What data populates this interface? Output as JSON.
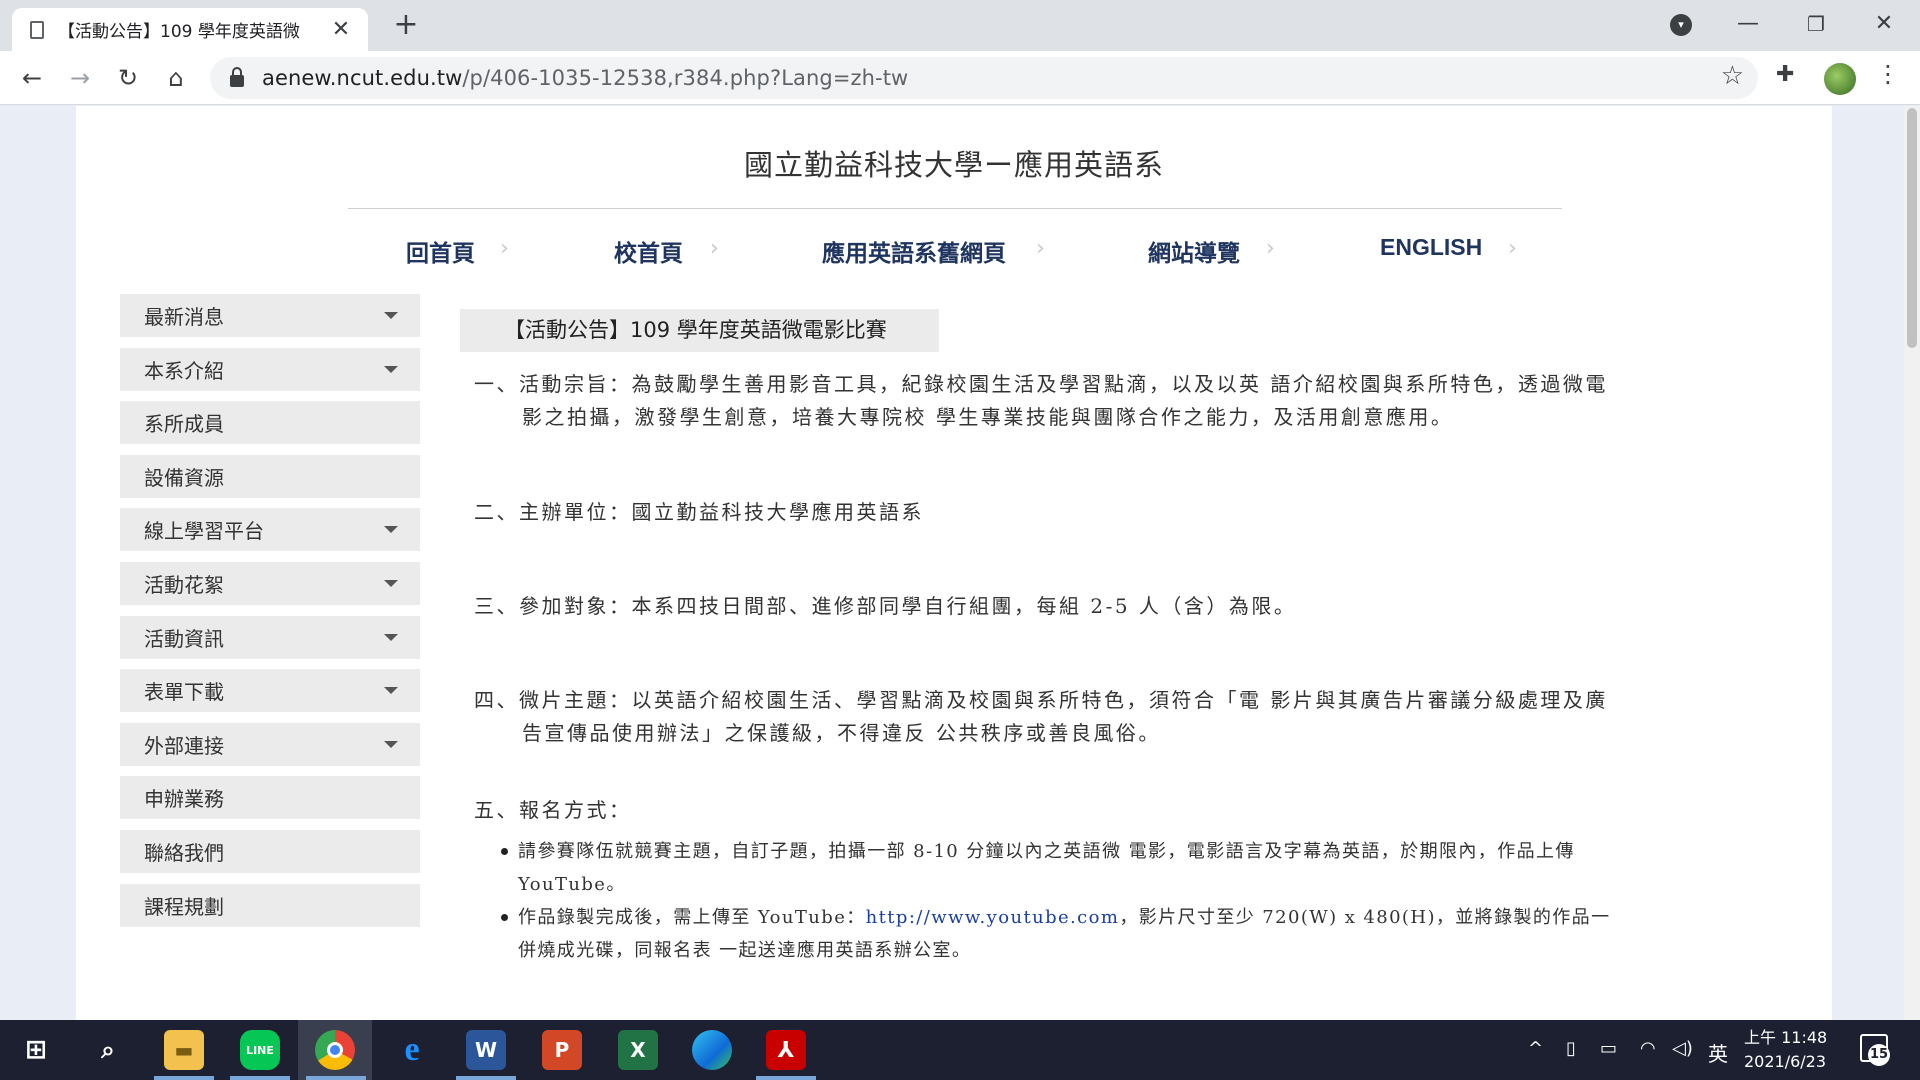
{
  "browser": {
    "tab_title": "【活動公告】109 學年度英語微",
    "url_host": "aenew.ncut.edu.tw",
    "url_path": "/p/406-1035-12538,r384.php?Lang=zh-tw"
  },
  "site": {
    "title": "國立勤益科技大學ー應用英語系",
    "nav": [
      "回首頁",
      "校首頁",
      "應用英語系舊網頁",
      "網站導覽",
      "ENGLISH"
    ]
  },
  "sidebar": {
    "items": [
      {
        "label": "最新消息",
        "has_submenu": true
      },
      {
        "label": "本系介紹",
        "has_submenu": true
      },
      {
        "label": "系所成員",
        "has_submenu": false
      },
      {
        "label": "設備資源",
        "has_submenu": false
      },
      {
        "label": "線上學習平台",
        "has_submenu": true
      },
      {
        "label": "活動花絮",
        "has_submenu": true
      },
      {
        "label": "活動資訊",
        "has_submenu": true
      },
      {
        "label": "表單下載",
        "has_submenu": true
      },
      {
        "label": "外部連接",
        "has_submenu": true
      },
      {
        "label": "申辦業務",
        "has_submenu": false
      },
      {
        "label": "聯絡我們",
        "has_submenu": false
      },
      {
        "label": "課程規劃",
        "has_submenu": false
      }
    ]
  },
  "post": {
    "title": "【活動公告】109 學年度英語微電影比賽",
    "sections": [
      "一、活動宗旨：為鼓勵學生善用影音工具，紀錄校園生活及學習點滴，以及以英 語介紹校園與系所特色，透過微電影之拍攝，激發學生創意，培養大專院校 學生專業技能與團隊合作之能力，及活用創意應用。",
      "二、主辦單位：國立勤益科技大學應用英語系",
      "三、參加對象：本系四技日間部、進修部同學自行組團，每組 2-5 人（含）為限。",
      "四、微片主題：以英語介紹校園生活、學習點滴及校園與系所特色，須符合「電 影片與其廣告片審議分級處理及廣告宣傳品使用辦法」之保護級，不得違反 公共秩序或善良風俗。",
      "五、報名方式："
    ],
    "bullet1": "請參賽隊伍就競賽主題，自訂子題，拍攝一部 8-10 分鐘以內之英語微 電影，電影語言及字幕為英語，於期限內，作品上傳 YouTube。",
    "bullet2_pre": "作品錄製完成後，需上傳至 YouTube：",
    "bullet2_link": "http://www.youtube.com",
    "bullet2_post": "，影片尺寸至少 720(W) x 480(H)，並將錄製的作品一併燒成光碟，同報名表 一起送達應用英語系辦公室。"
  },
  "taskbar": {
    "ime": "英",
    "time": "上午 11:48",
    "date": "2021/6/23",
    "notification_count": "15",
    "word_label": "W",
    "excel_label": "X",
    "ppt_label": "P",
    "line_label": "LINE"
  },
  "colors": {
    "nav_text": "#1f3560",
    "sidebar_bg": "#ebebeb",
    "link": "#1a3fa0",
    "taskbar": "#1c2030"
  }
}
